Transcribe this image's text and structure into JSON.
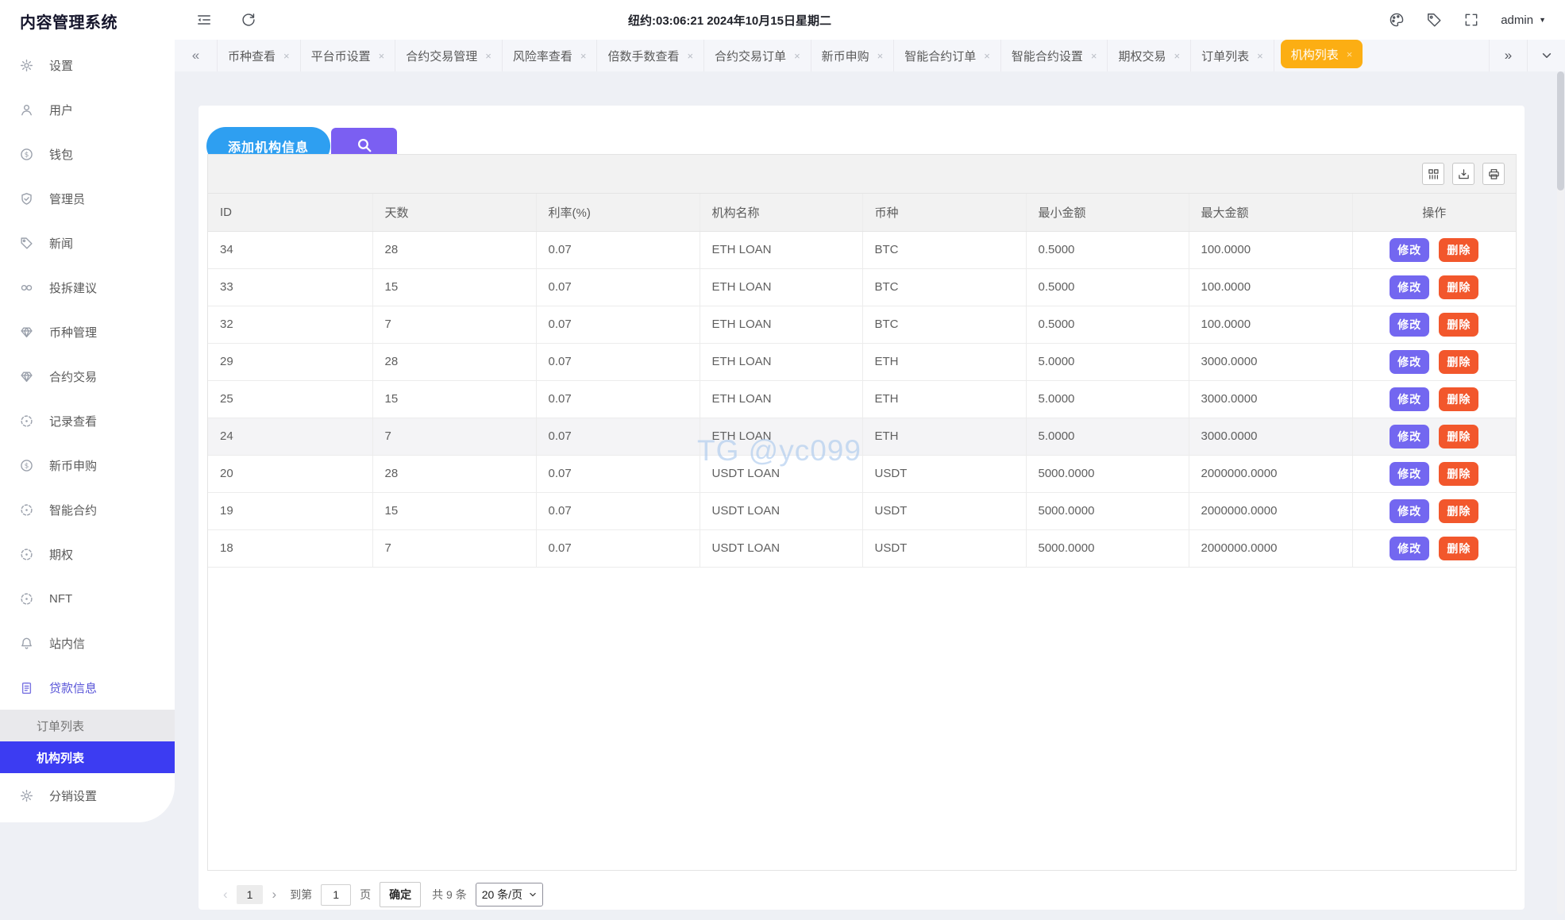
{
  "app": {
    "logo": "内容管理系统"
  },
  "header": {
    "clock": "纽约:03:06:21 2024年10月15日星期二",
    "user": "admin",
    "user_caret": "▼"
  },
  "sidebar": {
    "items": [
      {
        "label": "设置",
        "icon": "gear",
        "cls": ""
      },
      {
        "label": "用户",
        "icon": "user",
        "cls": ""
      },
      {
        "label": "钱包",
        "icon": "dollar",
        "cls": ""
      },
      {
        "label": "管理员",
        "icon": "shield",
        "cls": ""
      },
      {
        "label": "新闻",
        "icon": "tag",
        "cls": ""
      },
      {
        "label": "投拆建议",
        "icon": "link",
        "cls": ""
      },
      {
        "label": "币种管理",
        "icon": "diamond",
        "cls": ""
      },
      {
        "label": "合约交易",
        "icon": "diamond",
        "cls": ""
      },
      {
        "label": "记录查看",
        "icon": "history",
        "cls": ""
      },
      {
        "label": "新币申购",
        "icon": "dollar",
        "cls": ""
      },
      {
        "label": "智能合约",
        "icon": "history",
        "cls": ""
      },
      {
        "label": "期权",
        "icon": "history",
        "cls": ""
      },
      {
        "label": "NFT",
        "icon": "history",
        "cls": ""
      },
      {
        "label": "站内信",
        "icon": "bell",
        "cls": ""
      },
      {
        "label": "贷款信息",
        "icon": "clipboard",
        "cls": "parent-active"
      },
      {
        "label": "订单列表",
        "icon": "",
        "cls": "sub subhover"
      },
      {
        "label": "机构列表",
        "icon": "",
        "cls": "sub selected"
      },
      {
        "label": "分销设置",
        "icon": "gear",
        "cls": ""
      }
    ]
  },
  "tabbar": {
    "scroll_left": "«",
    "scroll_right": "»",
    "close_glyph": "×",
    "items": [
      {
        "label": "币种查看",
        "cls": ""
      },
      {
        "label": "平台币设置",
        "cls": ""
      },
      {
        "label": "合约交易管理",
        "cls": ""
      },
      {
        "label": "风险率查看",
        "cls": ""
      },
      {
        "label": "倍数手数查看",
        "cls": ""
      },
      {
        "label": "合约交易订单",
        "cls": ""
      },
      {
        "label": "新币申购",
        "cls": ""
      },
      {
        "label": "智能合约订单",
        "cls": ""
      },
      {
        "label": "智能合约设置",
        "cls": ""
      },
      {
        "label": "期权交易",
        "cls": ""
      },
      {
        "label": "订单列表",
        "cls": ""
      },
      {
        "label": "机构列表",
        "cls": "active"
      }
    ]
  },
  "toolbar": {
    "add_button": "添加机构信息"
  },
  "table": {
    "columns": [
      "ID",
      "天数",
      "利率(%)",
      "机构名称",
      "币种",
      "最小金额",
      "最大金额",
      "操作"
    ],
    "actions": {
      "edit": "修改",
      "del": "删除"
    },
    "rows": [
      {
        "id": "34",
        "days": "28",
        "rate": "0.07",
        "name": "ETH LOAN",
        "coin": "BTC",
        "min": "0.5000",
        "max": "100.0000",
        "cls": ""
      },
      {
        "id": "33",
        "days": "15",
        "rate": "0.07",
        "name": "ETH LOAN",
        "coin": "BTC",
        "min": "0.5000",
        "max": "100.0000",
        "cls": ""
      },
      {
        "id": "32",
        "days": "7",
        "rate": "0.07",
        "name": "ETH LOAN",
        "coin": "BTC",
        "min": "0.5000",
        "max": "100.0000",
        "cls": ""
      },
      {
        "id": "29",
        "days": "28",
        "rate": "0.07",
        "name": "ETH LOAN",
        "coin": "ETH",
        "min": "5.0000",
        "max": "3000.0000",
        "cls": ""
      },
      {
        "id": "25",
        "days": "15",
        "rate": "0.07",
        "name": "ETH LOAN",
        "coin": "ETH",
        "min": "5.0000",
        "max": "3000.0000",
        "cls": ""
      },
      {
        "id": "24",
        "days": "7",
        "rate": "0.07",
        "name": "ETH LOAN",
        "coin": "ETH",
        "min": "5.0000",
        "max": "3000.0000",
        "cls": "hl"
      },
      {
        "id": "20",
        "days": "28",
        "rate": "0.07",
        "name": "USDT LOAN",
        "coin": "USDT",
        "min": "5000.0000",
        "max": "2000000.0000",
        "cls": ""
      },
      {
        "id": "19",
        "days": "15",
        "rate": "0.07",
        "name": "USDT LOAN",
        "coin": "USDT",
        "min": "5000.0000",
        "max": "2000000.0000",
        "cls": ""
      },
      {
        "id": "18",
        "days": "7",
        "rate": "0.07",
        "name": "USDT LOAN",
        "coin": "USDT",
        "min": "5000.0000",
        "max": "2000000.0000",
        "cls": ""
      }
    ]
  },
  "pagination": {
    "prev": "‹",
    "current": "1",
    "next": "›",
    "goto_label": "到第",
    "goto_value": "1",
    "page_unit": "页",
    "confirm": "确定",
    "total": "共 9 条",
    "page_size": "20 条/页"
  },
  "watermark": "TG @yc099",
  "colors": {
    "accent_blue": "#2e9ff1",
    "accent_purple": "#7b5ff2",
    "active_tab_orange": "#fcae13",
    "selected_menu_indigo": "#3c3cf2",
    "edit_purple": "#7367f0",
    "delete_red": "#f2572c"
  }
}
